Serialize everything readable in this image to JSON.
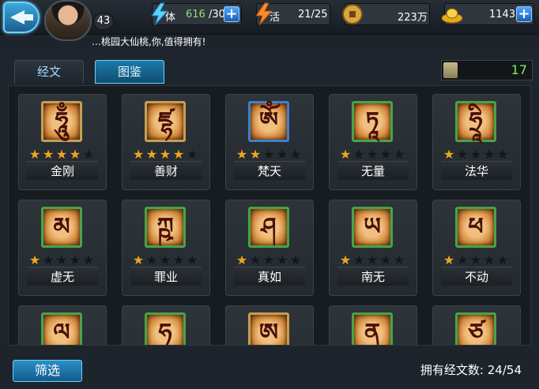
{
  "header": {
    "level": "43",
    "stamina": {
      "label": "体",
      "current": "616",
      "max": "/30"
    },
    "vitality": {
      "label": "活",
      "value": "21/25"
    },
    "coins": {
      "value": "223万"
    },
    "ingots": {
      "value": "1143"
    },
    "plus_label": "+"
  },
  "ticker": "…桃园大仙桃,你,值得拥有!",
  "tabs": [
    {
      "label": "经文",
      "active": false
    },
    {
      "label": "图鉴",
      "active": true
    }
  ],
  "scroll_count": "17",
  "cards": [
    {
      "name": "金刚",
      "glyph": "ཧཱུྃ",
      "stars": 4,
      "frame": "gold"
    },
    {
      "name": "善财",
      "glyph": "ཛྷ",
      "stars": 4,
      "frame": "gold"
    },
    {
      "name": "梵天",
      "glyph": "ཨོཾ",
      "stars": 2,
      "frame": "blue"
    },
    {
      "name": "无量",
      "glyph": "ཏཱ",
      "stars": 1,
      "frame": "green"
    },
    {
      "name": "法华",
      "glyph": "ཧྲཱི",
      "stars": 1,
      "frame": "green"
    },
    {
      "name": "虚无",
      "glyph": "མ",
      "stars": 1,
      "frame": "green"
    },
    {
      "name": "罪业",
      "glyph": "ཀྵ",
      "stars": 1,
      "frame": "green"
    },
    {
      "name": "真如",
      "glyph": "ཤ",
      "stars": 1,
      "frame": "green"
    },
    {
      "name": "南无",
      "glyph": "ཡ",
      "stars": 1,
      "frame": "green"
    },
    {
      "name": "不动",
      "glyph": "ཕ",
      "stars": 1,
      "frame": "green"
    },
    {
      "name": "",
      "glyph": "ལ",
      "stars": 0,
      "frame": "green"
    },
    {
      "name": "",
      "glyph": "ཧ",
      "stars": 0,
      "frame": "green"
    },
    {
      "name": "",
      "glyph": "ཨ",
      "stars": 0,
      "frame": "gold"
    },
    {
      "name": "",
      "glyph": "ན",
      "stars": 0,
      "frame": "green"
    },
    {
      "name": "",
      "glyph": "ཙ",
      "stars": 0,
      "frame": "green"
    }
  ],
  "footer": {
    "filter_label": "筛选",
    "owned_label": "拥有经文数:",
    "owned_value": "24/54"
  },
  "colors": {
    "accent": "#6cd0ff",
    "star_on": "#f0a51c",
    "count_green": "#7fe860"
  },
  "icons": [
    "back-arrow-icon",
    "stamina-bolt-icon",
    "vitality-bolt-icon",
    "coin-icon",
    "gold-ingot-icon",
    "scroll-icon",
    "star-icon"
  ]
}
